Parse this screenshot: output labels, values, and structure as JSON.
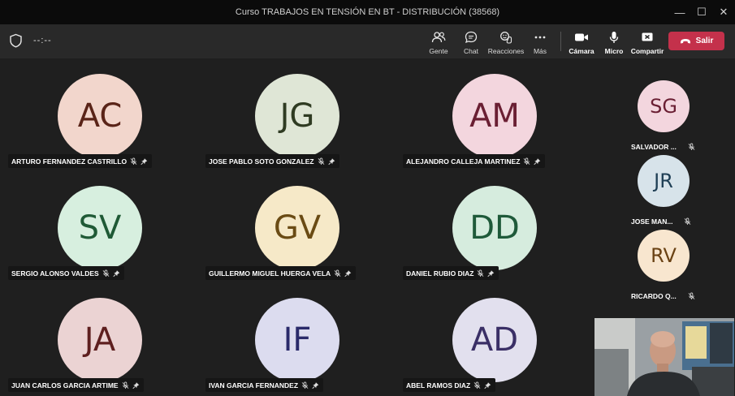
{
  "window": {
    "title": "Curso TRABAJOS EN TENSIÓN EN BT - DISTRIBUCIÓN (38568)",
    "minimize": "—",
    "maximize": "☐",
    "close": "✕"
  },
  "toolbar": {
    "timer": "--:--",
    "people_label": "Gente",
    "chat_label": "Chat",
    "reactions_label": "Reacciones",
    "more_label": "Más",
    "camera_label": "Cámara",
    "mic_label": "Micro",
    "share_label": "Compartir",
    "leave_label": "Salir",
    "leave_color": "#c4314b"
  },
  "participants": [
    {
      "initials": "AC",
      "name": "ARTURO FERNANDEZ CASTRILLO",
      "bg": "#f2d6cc",
      "fg": "#5a2418"
    },
    {
      "initials": "JG",
      "name": "JOSE PABLO SOTO GONZALEZ",
      "bg": "#dfe6d6",
      "fg": "#2f3b22"
    },
    {
      "initials": "AM",
      "name": "ALEJANDRO CALLEJA MARTINEZ",
      "bg": "#f3d6de",
      "fg": "#6a1f33"
    },
    {
      "initials": "SV",
      "name": "SERGIO ALONSO VALDES",
      "bg": "#d7efdf",
      "fg": "#1f5a36"
    },
    {
      "initials": "GV",
      "name": "GUILLERMO MIGUEL HUERGA VELA",
      "bg": "#f6e9c8",
      "fg": "#6a4b14"
    },
    {
      "initials": "DD",
      "name": "DANIEL RUBIO DIAZ",
      "bg": "#d6ecde",
      "fg": "#1f5a3a"
    },
    {
      "initials": "JA",
      "name": "JUAN CARLOS GARCIA ARTIME",
      "bg": "#ebd3d3",
      "fg": "#5e1f1f"
    },
    {
      "initials": "IF",
      "name": "IVAN GARCIA FERNANDEZ",
      "bg": "#dcdcef",
      "fg": "#2a2a6a"
    },
    {
      "initials": "AD",
      "name": "ABEL RAMOS DIAZ",
      "bg": "#e2e0ee",
      "fg": "#3a2f66"
    }
  ],
  "side_participants": [
    {
      "initials": "SG",
      "name": "SALVADOR ...",
      "bg": "#f3d6de",
      "fg": "#6a1f33"
    },
    {
      "initials": "JR",
      "name": "JOSE MAN...",
      "bg": "#d7e3ea",
      "fg": "#1f3f55"
    },
    {
      "initials": "RV",
      "name": "RICARDO Q...",
      "bg": "#f8e6cf",
      "fg": "#6a4214"
    }
  ]
}
